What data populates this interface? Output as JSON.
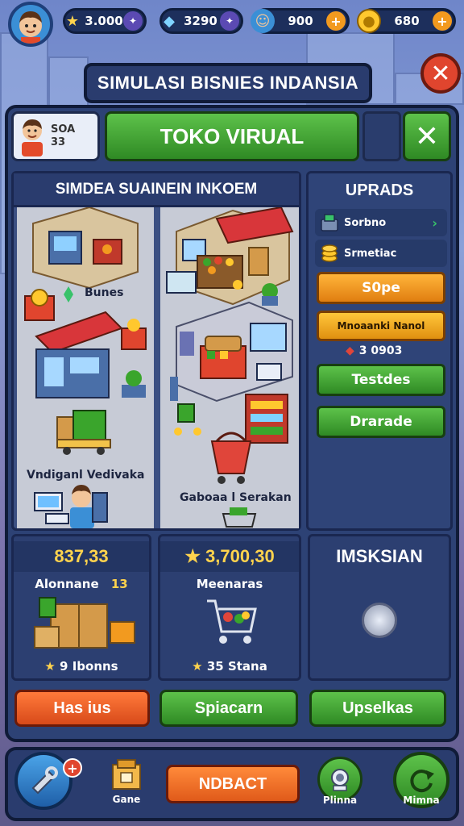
{
  "hud": {
    "stars": "3.000",
    "gems": "3290",
    "staff": "900",
    "coins": "680"
  },
  "title": "SIMULASI BISNIES INDANSIA",
  "header": {
    "mini_avatar_line1": "SOA",
    "mini_avatar_line2": "33",
    "main_button": "TOKO VIRUAL"
  },
  "store": {
    "title": "SIMDEA SUAINEIN INKOEM",
    "label_business": "Bunes",
    "label_left_bottom": "Vndiganl Vedivaka",
    "label_right_bottom": "Gaboaa l Serakan"
  },
  "upgrades": {
    "title": "UPRADS",
    "row1": "Sorbno",
    "row2": "Srmetiac",
    "btn_orange1": "S0pe",
    "btn_orange2": "Mnoaanki Nanol",
    "price": "3 0903",
    "btn_green1": "Testdes",
    "btn_green2": "Drarade"
  },
  "cards": {
    "card1_value": "837,33",
    "card1_label": "Alonnane",
    "card1_badge": "13",
    "card1_footer": "9 Ibonns",
    "card2_value": "3,700,30",
    "card2_label": "Meenaras",
    "card2_footer": "35 Stana",
    "card3_title": "IMSKSIAN"
  },
  "actions": {
    "btn1": "Has ius",
    "btn2": "Spiacarn",
    "btn3": "Upselkas"
  },
  "nav": {
    "game_label": "Gane",
    "center_button": "NDBACT",
    "right1_label": "Plinna",
    "right2_label": "Mimna"
  },
  "colors": {
    "panel": "#2d4275",
    "green": "#3aa52c",
    "orange": "#f29a1f",
    "red": "#e0452e",
    "gold": "#ffd34d"
  }
}
